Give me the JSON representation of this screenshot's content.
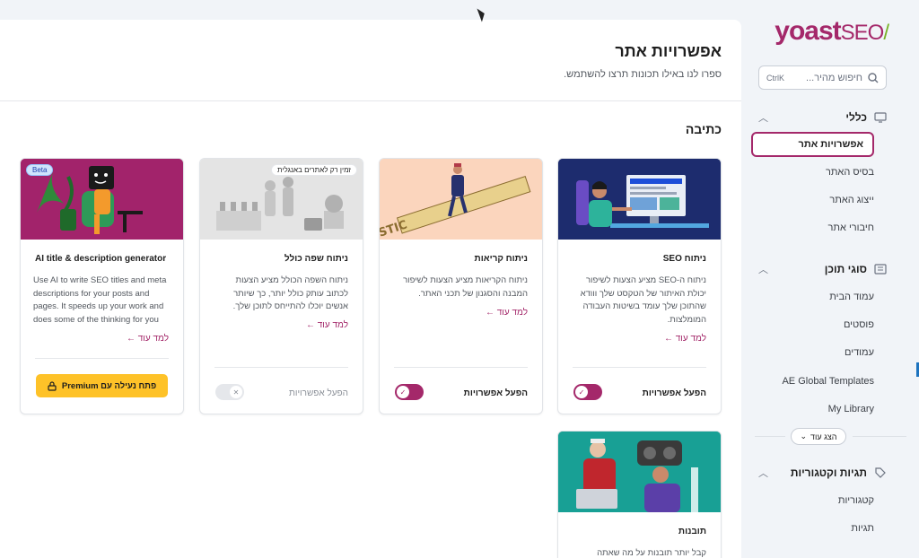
{
  "brand": {
    "logo_main": "yoast",
    "logo_seo": "SEO",
    "logo_slash": "/"
  },
  "search": {
    "placeholder": "חיפוש מהיר...",
    "shortcut": "CtrlK"
  },
  "sidebar": {
    "sections": [
      {
        "label": "כללי",
        "icon": "desktop-icon",
        "items": [
          "אפשרויות אתר",
          "בסיס האתר",
          "ייצוג האתר",
          "חיבורי אתר"
        ]
      },
      {
        "label": "סוגי תוכן",
        "icon": "content-icon",
        "items": [
          "עמוד הבית",
          "פוסטים",
          "עמודים",
          "AE Global Templates",
          "My Library"
        ]
      },
      {
        "label": "תגיות וקטגוריות",
        "icon": "tag-icon",
        "items": [
          "קטגוריות",
          "תגיות"
        ]
      }
    ],
    "show_more": "הצג עוד",
    "active_item": "אפשרויות אתר"
  },
  "page": {
    "title": "אפשרויות אתר",
    "subtitle": "ספרו לנו באילו תכונות תרצו להשתמש.",
    "category": "כתיבה"
  },
  "cards": [
    {
      "title": "ניתוח SEO",
      "desc": "ניתוח ה-SEO מציע הצעות לשיפור יכולת האיתור של הטקסט שלך ווודא שהתוכן שלך עומד בשיטות העבודה המומלצות.",
      "learn": "למד עוד ←",
      "toggle_label": "הפעל אפשרויות",
      "enabled": true
    },
    {
      "title": "ניתוח קריאות",
      "desc": "ניתוח הקריאות מציע הצעות לשיפור המבנה והסגנון של תכני האתר.",
      "learn": "למד עוד ←",
      "toggle_label": "הפעל אפשרויות",
      "enabled": true,
      "image_text": "SUPERCALIFRAGILISTIC"
    },
    {
      "title": "ניתוח שפה כולל",
      "desc": "ניתוח השפה הכולל מציע הצעות לכתוב עותק כולל יותר, כך שיותר אנשים יוכלו להתייחס לתוכן שלך.",
      "learn": "למד עוד ←",
      "toggle_label": "הפעל אפשרויות",
      "enabled": false,
      "badge": "זמין רק לאתרים באנגלית"
    },
    {
      "title": "AI title & description generator",
      "desc": "Use AI to write SEO titles and meta descriptions for your posts and pages. It speeds up your work and does some of the thinking for you",
      "learn": "למד עוד ←",
      "premium_label": "פתח נעילה עם Premium",
      "badge": "Beta"
    },
    {
      "title": "תובנות",
      "desc": "קבל יותר תובנות על מה שאתה"
    }
  ]
}
